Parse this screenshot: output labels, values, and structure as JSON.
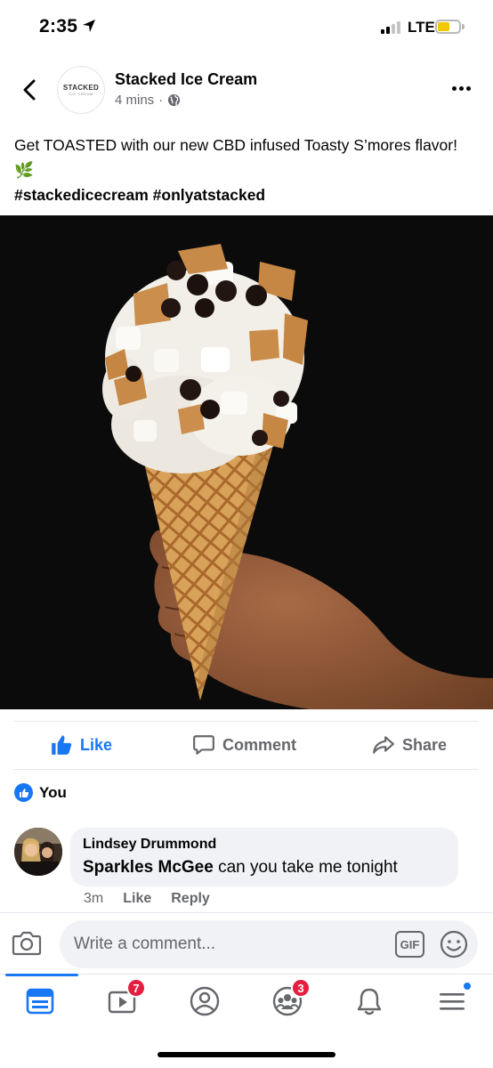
{
  "status_bar": {
    "time": "2:35",
    "network": "LTE",
    "battery_color": "#f2c800"
  },
  "post": {
    "page_name": "Stacked Ice Cream",
    "logo_text": "STACKED",
    "logo_subtext": "ICE CREAM",
    "timestamp": "4 mins",
    "meta_separator": "·",
    "caption": "Get TOASTED with our new CBD infused Toasty S’mores flavor! 🌿",
    "hashtags": "#stackedicecream #onlyatstacked"
  },
  "actions": {
    "like_label": "Like",
    "comment_label": "Comment",
    "share_label": "Share"
  },
  "reactions": {
    "text": "You"
  },
  "comment": {
    "author": "Lindsey Drummond",
    "mention": "Sparkles McGee",
    "text": " can you take me tonight",
    "time": "3m",
    "like_label": "Like",
    "reply_label": "Reply"
  },
  "composer": {
    "placeholder": "Write a comment...",
    "gif_label": "GIF"
  },
  "tab_bar": {
    "watch_badge": "7",
    "groups_badge": "3"
  },
  "colors": {
    "accent": "#1877f2",
    "badge": "#e41e3f",
    "secondary_text": "#65676b"
  },
  "icons": [
    "location-arrow-icon",
    "signal-icon",
    "battery-icon",
    "back-chevron-icon",
    "globe-icon",
    "more-dots-icon",
    "thumbs-up-icon",
    "comment-icon",
    "share-icon",
    "camera-icon",
    "emoji-icon",
    "news-feed-icon",
    "watch-icon",
    "profile-icon",
    "groups-icon",
    "bell-icon",
    "menu-icon"
  ]
}
